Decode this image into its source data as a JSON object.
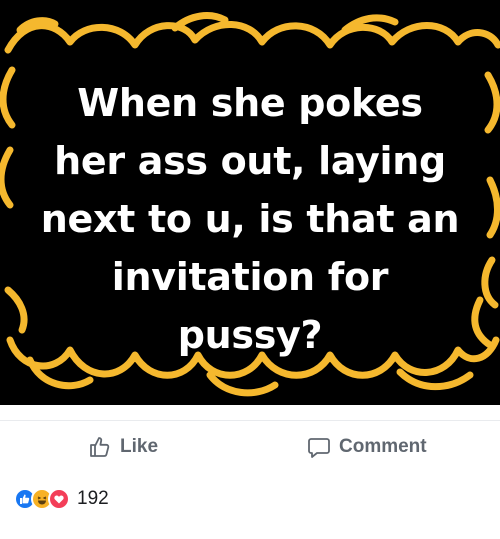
{
  "post": {
    "image_text": "When she pokes her ass out, laying next to u, is that an invitation for pussy?",
    "image_lines": [
      "When she pokes",
      "her ass out, laying",
      "next to u, is that an",
      "invitation for",
      "pussy?"
    ],
    "background_color": "#000000",
    "frame_color": "#f5b82e"
  },
  "actions": {
    "like_label": "Like",
    "comment_label": "Comment"
  },
  "reactions": {
    "icons": [
      "like-reaction",
      "haha-reaction",
      "love-reaction"
    ],
    "count": "192",
    "colors": {
      "like": "#1877f2",
      "haha": "#f7b125",
      "love": "#f33e58"
    }
  }
}
